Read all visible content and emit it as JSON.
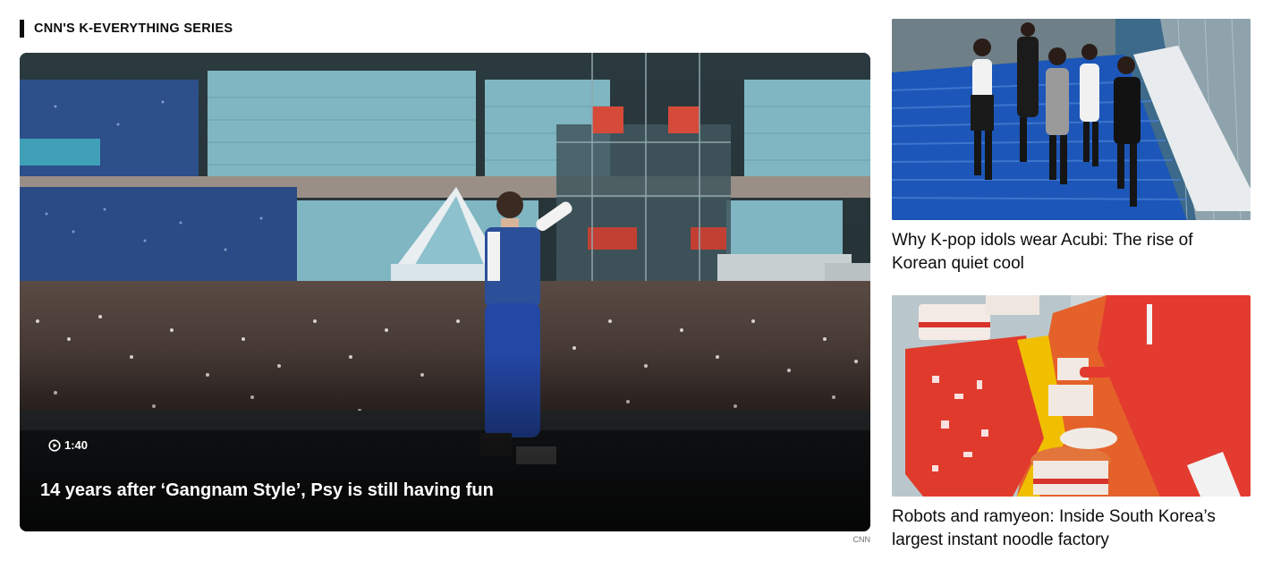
{
  "section": {
    "title": "CNN'S K-EVERYTHING SERIES"
  },
  "main_story": {
    "duration": "1:40",
    "headline": "14 years after ‘Gangnam Style’, Psy is still having fun",
    "credit": "CNN"
  },
  "side_stories": [
    {
      "headline": "Why K-pop idols wear Acubi: The rise of Korean quiet cool"
    },
    {
      "headline": "Robots and ramyeon: Inside South Korea’s largest instant noodle factory"
    }
  ],
  "icons": {
    "play": "play-circle-icon"
  }
}
